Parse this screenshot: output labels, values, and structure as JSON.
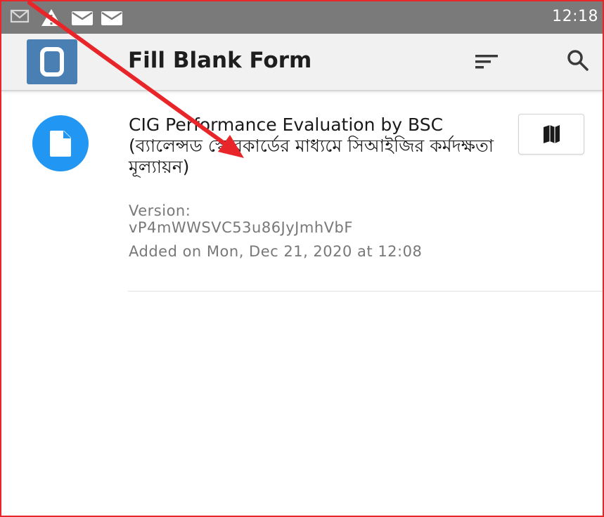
{
  "status_bar": {
    "time": "12:18",
    "icons": [
      "gmail-icon",
      "warning-icon",
      "mail-icon",
      "mail-icon"
    ]
  },
  "app_bar": {
    "title": "Fill Blank Form",
    "logo_icon": "app-logo-icon",
    "sort_icon": "sort-icon",
    "search_icon": "search-icon"
  },
  "forms": [
    {
      "title": "CIG Performance Evaluation by BSC (ব্যালেন্সড স্কোরকার্ডের মাধ্যমে সিআইজির কর্মদক্ষতা মূল্যায়ন)",
      "version_label": "Version:",
      "version": "vP4mWWSVC53u86JyJmhVbF",
      "added": "Added on Mon, Dec 21, 2020 at 12:08",
      "icon": "form-file-icon",
      "action_icon": "map-icon"
    }
  ],
  "colors": {
    "status_bar": "#7a7a7a",
    "app_bar": "#f1f1f1",
    "logo": "#4a7fb3",
    "form_icon": "#2196f3",
    "frame_border": "#e8262a",
    "annotation_arrow": "#e8262a",
    "secondary_text": "#787878"
  }
}
